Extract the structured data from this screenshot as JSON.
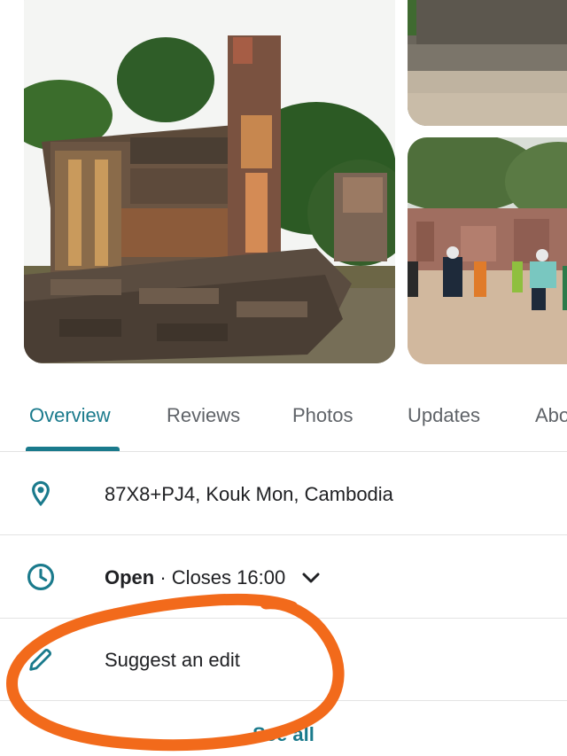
{
  "tabs": [
    {
      "label": "Overview"
    },
    {
      "label": "Reviews"
    },
    {
      "label": "Photos"
    },
    {
      "label": "Updates"
    },
    {
      "label": "Abo"
    }
  ],
  "info": {
    "address": "87X8+PJ4, Kouk Mon, Cambodia",
    "hours_status": "Open",
    "hours_separator": " · ",
    "hours_close": "Closes 16:00",
    "suggest_edit": "Suggest an edit"
  },
  "see_all": "See all",
  "colors": {
    "accent": "#1a7a8c",
    "annotation": "#f26a1b"
  },
  "icons": {
    "address": "location-pin-icon",
    "hours": "clock-icon",
    "edit": "pencil-icon",
    "expand": "chevron-down-icon"
  }
}
